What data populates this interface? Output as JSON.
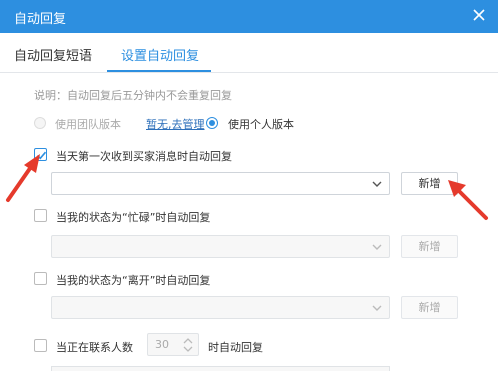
{
  "window": {
    "title": "自动回复"
  },
  "tabs": [
    {
      "label": "自动回复短语",
      "active": false
    },
    {
      "label": "设置自动回复",
      "active": true
    }
  ],
  "hint": "说明：自动回复后五分钟内不会重复回复",
  "version": {
    "team_label": "使用团队版本",
    "team_link": "暂无,去管理",
    "personal_label": "使用个人版本",
    "selected": "personal"
  },
  "rules": [
    {
      "label": "当天第一次收到买家消息时自动回复",
      "checked": true,
      "select_value": "",
      "add_label": "新增",
      "enabled": true
    },
    {
      "label": "当我的状态为“忙碌”时自动回复",
      "checked": false,
      "select_value": "",
      "add_label": "新增",
      "enabled": false
    },
    {
      "label": "当我的状态为“离开”时自动回复",
      "checked": false,
      "select_value": "",
      "add_label": "新增",
      "enabled": false
    }
  ],
  "contacts_rule": {
    "prefix": "当正在联系人数",
    "count": "30",
    "suffix": "时自动回复",
    "checked": false
  },
  "colors": {
    "accent": "#2d8fe0",
    "annotation_arrow": "#e53a2c"
  }
}
